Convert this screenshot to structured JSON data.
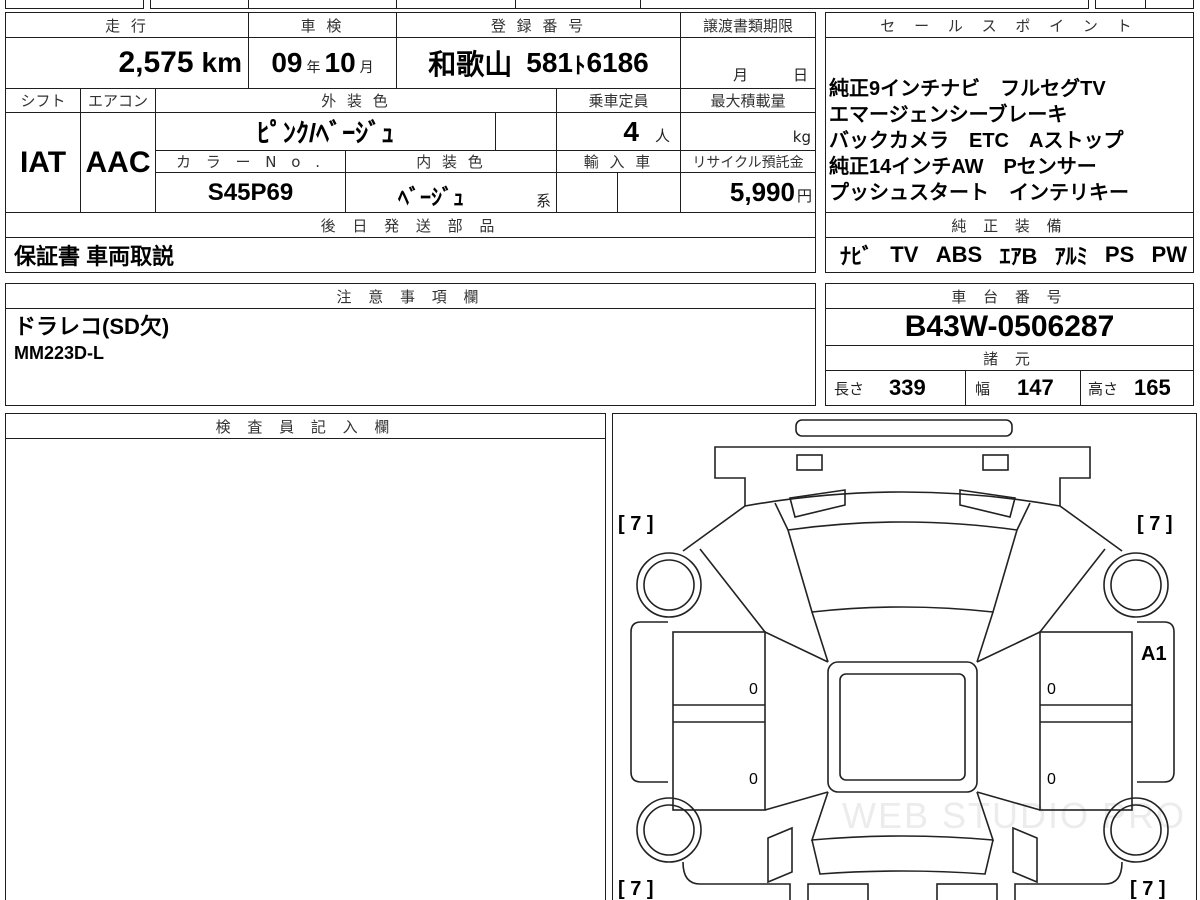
{
  "mileage": {
    "label": "走 行",
    "value": "2,575",
    "unit": "km"
  },
  "inspection": {
    "label": "車 検",
    "year": "09",
    "year_unit": "年",
    "month": "10",
    "month_unit": "月"
  },
  "registration": {
    "label": "登 録 番 号",
    "region": "和歌山",
    "class_no": "581",
    "kana": "ﾄ",
    "number": "6186"
  },
  "transfer_deadline": {
    "label": "譲渡書類期限",
    "month_unit": "月",
    "day_unit": "日"
  },
  "shift": {
    "label": "シフト",
    "value": "IAT"
  },
  "aircon": {
    "label": "エアコン",
    "value": "AAC"
  },
  "exterior_color": {
    "label": "外 装 色",
    "value": "ﾋﾟﾝｸ/ﾍﾞｰｼﾞｭ"
  },
  "capacity": {
    "label": "乗車定員",
    "value": "4",
    "unit": "人"
  },
  "max_load": {
    "label": "最大積載量",
    "unit": "kg"
  },
  "color_no": {
    "label": "カ ラ ー N o .",
    "value": "S45P69"
  },
  "interior_color": {
    "label": "内 装 色",
    "value": "ﾍﾞｰｼﾞｭ",
    "suffix": "系"
  },
  "import_car": {
    "label": "輸 入 車"
  },
  "recycle_deposit": {
    "label": "リサイクル預託金",
    "value": "5,990",
    "unit": "円"
  },
  "later_shipping_parts": {
    "label": "後 日 発 送 部 品",
    "value": "保証書 車両取説"
  },
  "sales_points": {
    "label": "セ ー ル ス ポ イ ン ト",
    "lines": [
      "純正9インチナビ　フルセグTV",
      "エマージェンシーブレーキ",
      "バックカメラ　ETC　Aストップ",
      "純正14インチAW　Pセンサー",
      "プッシュスタート　インテリキー"
    ]
  },
  "genuine_equipment": {
    "label": "純 正 装 備",
    "items": [
      "ﾅﾋﾞ",
      "TV",
      "ABS",
      "ｴｱB",
      "ｱﾙﾐ",
      "PS",
      "PW"
    ]
  },
  "notes": {
    "label": "注 意 事 項 欄",
    "lines": [
      "ドラレコ(SD欠)",
      "MM223D-L"
    ]
  },
  "chassis": {
    "label": "車 台 番 号",
    "value": "B43W-0506287"
  },
  "specs": {
    "label": "諸 元",
    "length_label": "長さ",
    "length": "339",
    "width_label": "幅",
    "width": "147",
    "height_label": "高さ",
    "height": "165"
  },
  "inspector_notes": {
    "label": "検 査 員 記 入 欄"
  },
  "diagram": {
    "corner_marks": [
      "[ 7 ]",
      "[ 7 ]",
      "[ 7 ]",
      "[ 7 ]"
    ],
    "damage_code": "A1",
    "door_marks": [
      "0",
      "0",
      "0",
      "0"
    ],
    "watermark": "WEB STUDIO PRO"
  },
  "colors": {
    "line": "#1e1e1e",
    "label_text": "#333333",
    "value_text": "#000000"
  }
}
